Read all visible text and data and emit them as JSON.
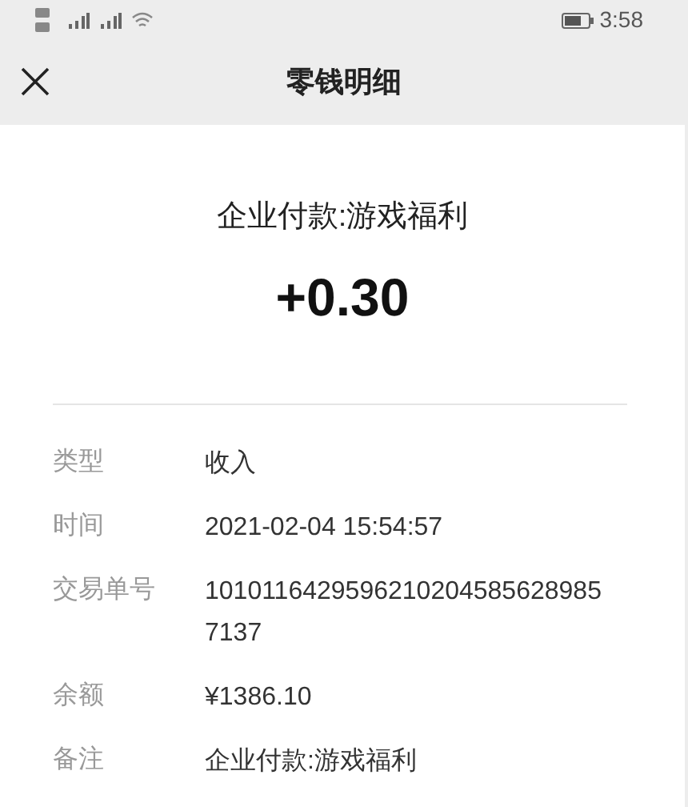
{
  "status_bar": {
    "time": "3:58"
  },
  "header": {
    "title": "零钱明细"
  },
  "summary": {
    "description": "企业付款:游戏福利",
    "amount": "+0.30"
  },
  "details": [
    {
      "label": "类型",
      "value": "收入"
    },
    {
      "label": "时间",
      "value": "2021-02-04 15:54:57"
    },
    {
      "label": "交易单号",
      "value": "10101164295962102045856289857137"
    },
    {
      "label": "余额",
      "value": "¥1386.10"
    },
    {
      "label": "备注",
      "value": "企业付款:游戏福利"
    }
  ]
}
